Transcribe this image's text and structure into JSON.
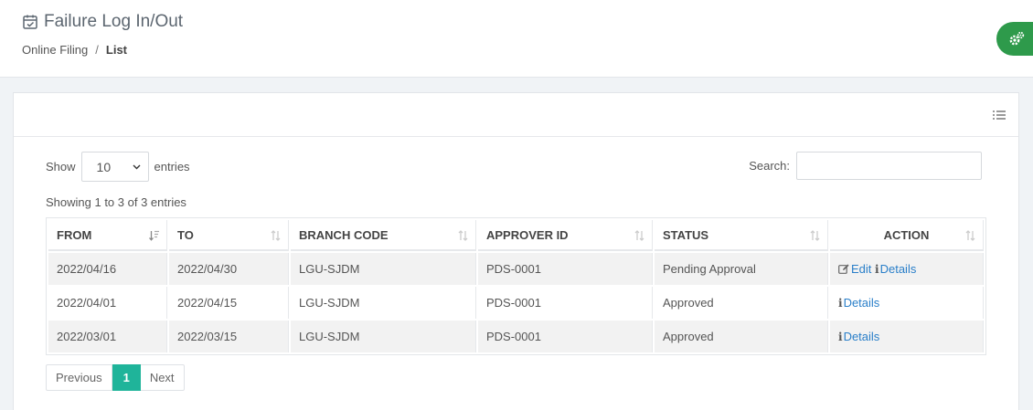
{
  "header": {
    "title": "Failure Log In/Out",
    "title_icon": "calendar-check-icon",
    "breadcrumb": {
      "parent": "Online Filing",
      "separator": "/",
      "current": "List"
    },
    "settings_icon": "gears-icon",
    "settings_color": "#2e9a4b"
  },
  "controls": {
    "show_label": "Show",
    "entries_label": "entries",
    "length_value": "10",
    "search_label": "Search:",
    "search_value": "",
    "search_placeholder": ""
  },
  "info": "Showing 1 to 3 of 3 entries",
  "table": {
    "columns": [
      "FROM",
      "TO",
      "BRANCH CODE",
      "APPROVER ID",
      "STATUS",
      "ACTION"
    ],
    "rows": [
      {
        "from": "2022/04/16",
        "to": "2022/04/30",
        "branch": "LGU-SJDM",
        "approver": "PDS-0001",
        "status": "Pending Approval",
        "edit": "Edit",
        "details": "Details"
      },
      {
        "from": "2022/04/01",
        "to": "2022/04/15",
        "branch": "LGU-SJDM",
        "approver": "PDS-0001",
        "status": "Approved",
        "details": "Details"
      },
      {
        "from": "2022/03/01",
        "to": "2022/03/15",
        "branch": "LGU-SJDM",
        "approver": "PDS-0001",
        "status": "Approved",
        "details": "Details"
      }
    ]
  },
  "pagination": {
    "previous": "Previous",
    "current_page": "1",
    "next": "Next",
    "active_color": "#1fb49a"
  },
  "colors": {
    "link": "#2a7fc9",
    "accent": "#1fb49a",
    "fab": "#2e9a4b"
  }
}
